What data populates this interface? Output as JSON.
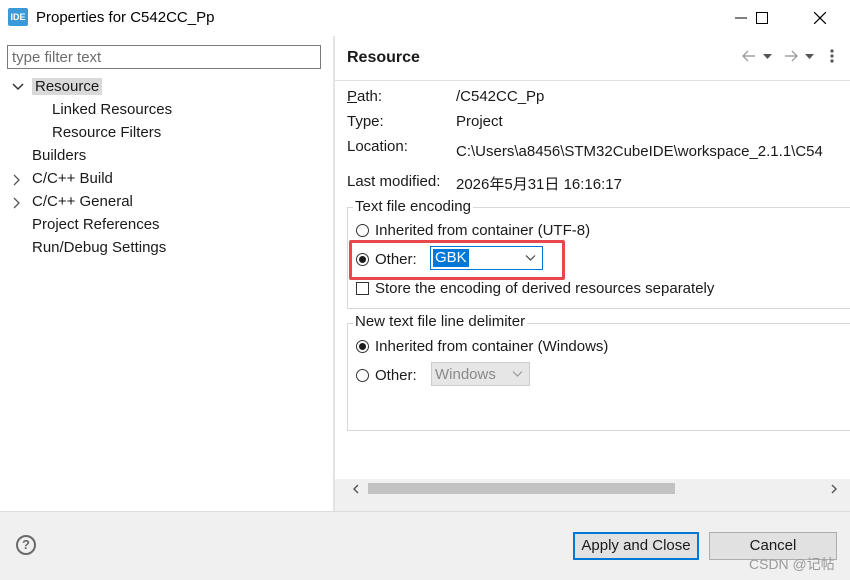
{
  "window": {
    "app_icon_text": "IDE",
    "title": "Properties for C542CC_Pp"
  },
  "filter": {
    "placeholder": "type filter text"
  },
  "tree": {
    "resource": "Resource",
    "linked_resources": "Linked Resources",
    "resource_filters": "Resource Filters",
    "builders": "Builders",
    "cc_build": "C/C++ Build",
    "cc_general": "C/C++ General",
    "project_references": "Project References",
    "run_debug_settings": "Run/Debug Settings"
  },
  "page": {
    "title": "Resource",
    "path_label": "Path:",
    "path_value": "/C542CC_Pp",
    "type_label": "Type:",
    "type_value": "Project",
    "location_label": "Location:",
    "location_value": "C:\\Users\\a8456\\STM32CubeIDE\\workspace_2.1.1\\C54",
    "last_modified_label": "Last modified:",
    "last_modified_value": "2026年5月31日 16:16:17"
  },
  "encoding": {
    "group_title": "Text file encoding",
    "inherited_label": "Inherited from container (UTF-8)",
    "other_label": "Other:",
    "other_value": "GBK",
    "store_label": "Store the encoding of derived resources separately"
  },
  "delimiter": {
    "group_title": "New text file line delimiter",
    "inherited_label": "Inherited from container (Windows)",
    "other_label": "Other:",
    "other_value": "Windows"
  },
  "buttons": {
    "help": "?",
    "apply_close": "Apply and Close",
    "cancel": "Cancel"
  },
  "watermark": "CSDN @记帖"
}
